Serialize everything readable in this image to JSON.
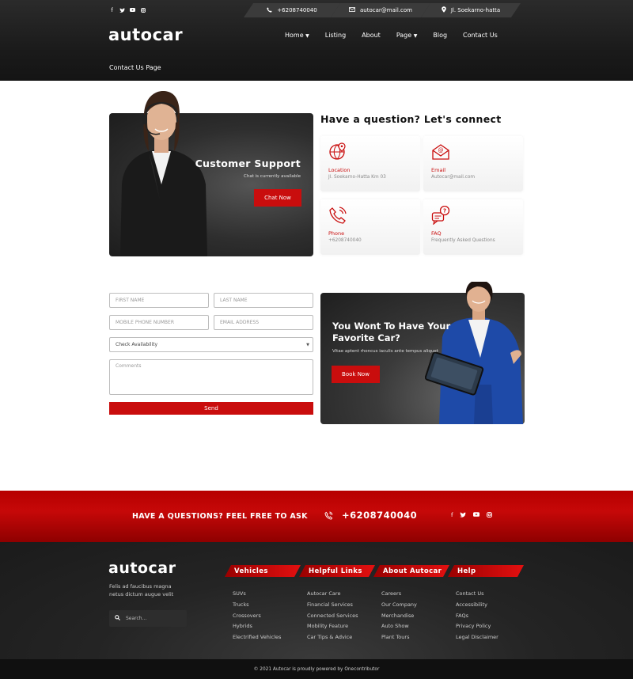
{
  "topbar": {
    "social": [
      "facebook-icon",
      "twitter-icon",
      "youtube-icon",
      "instagram-icon"
    ],
    "phone": "+6208740040",
    "email": "autocar@mail.com",
    "address": "Jl. Soekarno-hatta"
  },
  "header": {
    "logo": "autocar",
    "nav": [
      "Home",
      "Listing",
      "About",
      "Page",
      "Blog",
      "Contact Us"
    ],
    "breadcrumb": "Contact Us Page"
  },
  "support": {
    "title": "Customer Support",
    "status": "Chat is currently available",
    "button": "Chat Now"
  },
  "contact": {
    "heading": "Have a question? Let's connect",
    "cards": [
      {
        "label": "Location",
        "value": "Jl. Soekarno-Hatta Km 03"
      },
      {
        "label": "Email",
        "value": "Autocar@mail.com"
      },
      {
        "label": "Phone",
        "value": "+6208740040"
      },
      {
        "label": "FAQ",
        "value": "Frequently Asked Questions"
      }
    ]
  },
  "form": {
    "first_name": "FIRST NAME",
    "last_name": "LAST NAME",
    "mobile": "MOBILE PHONE NUMBER",
    "email": "EMAIL ADDRESS",
    "availability": "Check Availability",
    "comments": "Comments",
    "send": "Send"
  },
  "promo": {
    "title": "You Wont To Have Your Favorite Car?",
    "subtitle": "Vitae aptent rhoncus iaculis ante tempus aliquet",
    "button": "Book Now"
  },
  "band": {
    "text": "HAVE A QUESTIONS? FEEL FREE TO ASK",
    "phone": "+6208740040"
  },
  "footer": {
    "logo": "autocar",
    "description": "Felis ad faucibus magna netus dictum augue velit",
    "search_placeholder": "Search...",
    "columns": [
      {
        "title": "Vehicles",
        "links": [
          "SUVs",
          "Trucks",
          "Crossovers",
          "Hybrids",
          "Electrified Vehicles"
        ]
      },
      {
        "title": "Helpful Links",
        "links": [
          "Autocar Care",
          "Financial Services",
          "Connected Services",
          "Mobility Feature",
          "Car Tips & Advice"
        ]
      },
      {
        "title": "About Autocar",
        "links": [
          "Careers",
          "Our Company",
          "Merchandise",
          "Auto Show",
          "Plant Tours"
        ]
      },
      {
        "title": "Help",
        "links": [
          "Contact Us",
          "Accessibility",
          "FAQs",
          "Privacy Policy",
          "Legal Disclaimer"
        ]
      }
    ],
    "copyright": "© 2021 Autocar is proudly powered by Onecontributor"
  },
  "colors": {
    "accent": "#c90d0d",
    "dark": "#1b1b1b"
  }
}
